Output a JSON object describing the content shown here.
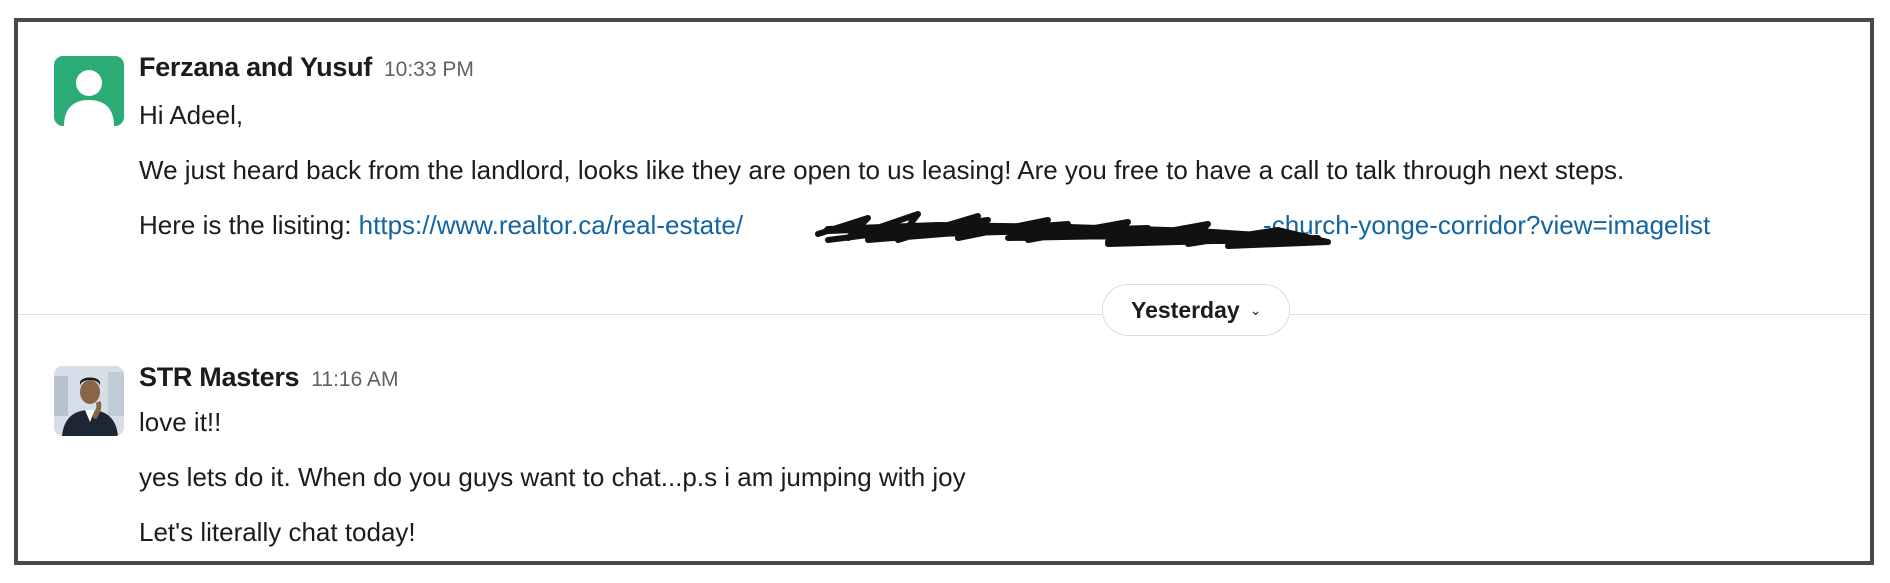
{
  "messages": [
    {
      "sender": "Ferzana and Yusuf",
      "time": "10:33 PM",
      "avatar_icon": "user-silhouette-icon",
      "lines": {
        "greeting": "Hi Adeel,",
        "body": "We just heard back from the landlord, looks like they are open to us leasing! Are you free to have a call to talk through next steps.",
        "listing_prefix": "Here is the lisiting: ",
        "link_start": "https://www.realtor.ca/real-estate/",
        "link_end": "-church-yonge-corridor?view=imagelist"
      }
    },
    {
      "sender": "STR Masters",
      "time": "11:16 AM",
      "avatar_icon": "profile-photo",
      "lines": {
        "l1": "love it!!",
        "l2": "yes lets do it. When do you guys want to chat...p.s i am jumping with joy",
        "l3": "Let's literally chat today!"
      }
    }
  ],
  "date_divider": {
    "label": "Yesterday",
    "icon": "chevron-down-icon"
  },
  "colors": {
    "link": "#1264a3",
    "avatar_green": "#2bac76",
    "border": "#4a4a4a"
  }
}
